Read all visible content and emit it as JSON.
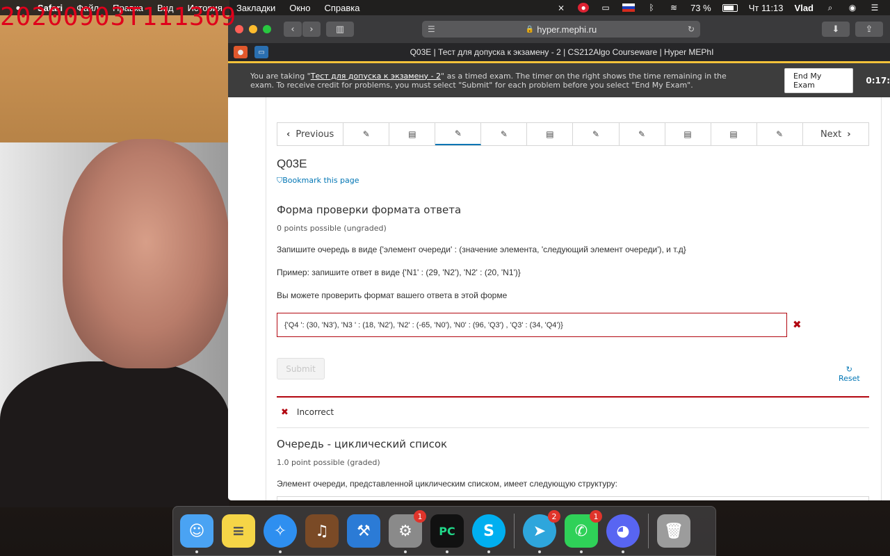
{
  "overlay": {
    "timestamp": "20200903T111309"
  },
  "menubar": {
    "items": [
      "Safari",
      "Файл",
      "Правка",
      "Вид",
      "История",
      "Закладки",
      "Окно",
      "Справка"
    ],
    "battery": "73 %",
    "clock": "Чт 11:13",
    "user": "Vlad"
  },
  "browser": {
    "url": "hyper.mephi.ru",
    "tab_title": "Q03E | Тест для допуска к экзамену - 2 | CS212Algo Courseware | Hyper MEPhI"
  },
  "exam_banner": {
    "msg_prefix": "You are taking \"",
    "exam_name": "Тест для допуска к экзамену - 2",
    "msg_suffix": "\" as a timed exam. The timer on the right shows the time remaining in the exam. To receive credit for problems, you must select \"Submit\" for each problem before you select \"End My Exam\".",
    "end_button": "End My Exam",
    "timer": "0:17:"
  },
  "sequence_nav": {
    "prev_label": "Previous",
    "next_label": "Next",
    "items": [
      {
        "icon": "edit-icon",
        "glyph": "✎"
      },
      {
        "icon": "book-icon",
        "glyph": "▤"
      },
      {
        "icon": "edit-icon",
        "glyph": "✎",
        "active": true
      },
      {
        "icon": "edit-icon",
        "glyph": "✎"
      },
      {
        "icon": "book-icon",
        "glyph": "▤"
      },
      {
        "icon": "edit-icon",
        "glyph": "✎"
      },
      {
        "icon": "edit-icon",
        "glyph": "✎"
      },
      {
        "icon": "book-icon",
        "glyph": "▤"
      },
      {
        "icon": "book-icon",
        "glyph": "▤"
      },
      {
        "icon": "edit-icon",
        "glyph": "✎"
      }
    ]
  },
  "unit": {
    "title": "Q03E",
    "bookmark": "Bookmark this page"
  },
  "problem1": {
    "title": "Форма проверки формата ответа",
    "points": "0 points possible (ungraded)",
    "line1": "Запишите очередь в виде {'элемент очереди' : (значение элемента, 'следующий элемент очереди'), и т.д}",
    "line2": "Пример: запишите ответ в виде {'N1' : (29, 'N2'), 'N2' : (20, 'N1')}",
    "line3": "Вы можете проверить формат вашего ответа в этой форме",
    "answer": "{'Q4 ': (30, 'N3'), 'N3 ' : (18, 'N2'), 'N2' : (-65, 'N0'), 'N0' : (96, 'Q3') , 'Q3' : (34, 'Q4')}",
    "submit": "Submit",
    "reset": "Reset",
    "feedback": "Incorrect"
  },
  "problem2": {
    "title": "Очередь - циклический список",
    "points": "1.0 point possible (graded)",
    "text": "Элемент очереди, представленной циклическим списком, имеет следующую структуру:"
  },
  "dock": [
    {
      "name": "finder-icon",
      "color": "#4aa3f3"
    },
    {
      "name": "notes-icon",
      "color": "#f5d547"
    },
    {
      "name": "safari-icon",
      "color": "#2e8ff0"
    },
    {
      "name": "garageband-icon",
      "color": "#7a4a26"
    },
    {
      "name": "xcode-icon",
      "color": "#2b7bd6"
    },
    {
      "name": "system-preferences-icon",
      "color": "#8a8a8a",
      "badge": "1"
    },
    {
      "name": "pycharm-icon",
      "color": "#21d789"
    },
    {
      "name": "skype-icon",
      "color": "#00aff0"
    },
    {
      "name": "telegram-icon",
      "color": "#2ea6dc",
      "badge": "2"
    },
    {
      "name": "facetime-icon",
      "color": "#2fd158",
      "badge": "1"
    },
    {
      "name": "discord-icon",
      "color": "#5865f2"
    },
    {
      "name": "trash-icon",
      "color": "#9c9c9c"
    }
  ],
  "colors": {
    "accent": "#0075b4",
    "error": "#b20610",
    "banner_border": "#f3c23a"
  }
}
